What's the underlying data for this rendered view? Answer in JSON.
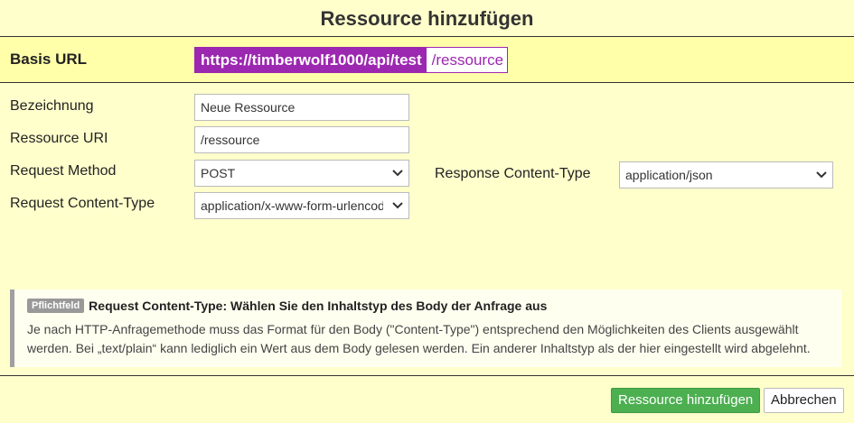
{
  "dialog": {
    "title": "Ressource hinzufügen"
  },
  "base_url": {
    "label": "Basis URL",
    "base": "https://timberwolf1000/api/test",
    "suffix": "/ressource"
  },
  "form": {
    "name_label": "Bezeichnung",
    "name_value": "Neue Ressource",
    "uri_label": "Ressource URI",
    "uri_value": "/ressource",
    "method_label": "Request Method",
    "method_value": "POST",
    "req_ct_label": "Request Content-Type",
    "req_ct_value": "application/x-www-form-urlencoded",
    "resp_ct_label": "Response Content-Type",
    "resp_ct_value": "application/json"
  },
  "info": {
    "badge": "Pflichtfeld",
    "title": "Request Content-Type: Wählen Sie den Inhaltstyp des Body der Anfrage aus",
    "text": "Je nach HTTP-Anfragemethode muss das Format für den Body (\"Content-Type\") entsprechend den Möglichkeiten des Clients ausgewählt werden. Bei „text/plain“ kann lediglich ein Wert aus dem Body gelesen werden. Ein anderer Inhaltstyp als der hier eingestellt wird abgelehnt."
  },
  "footer": {
    "add_label": "Ressource hinzufügen",
    "cancel_label": "Abbrechen"
  },
  "colors": {
    "background": "#ffffcc",
    "url_accent": "#9c27b0",
    "primary_button": "#4caf50"
  }
}
